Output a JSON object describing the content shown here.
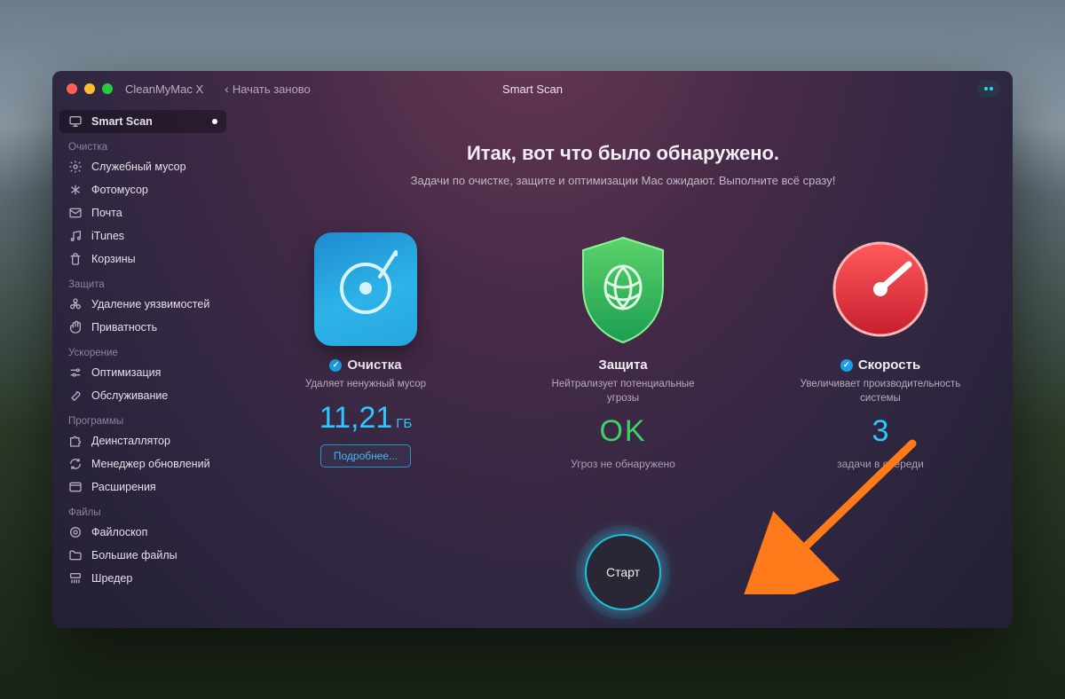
{
  "titlebar": {
    "app_title": "CleanMyMac X",
    "restart_label": "Начать заново",
    "center_title": "Smart Scan"
  },
  "sidebar": {
    "smart_scan": "Smart Scan",
    "sections": [
      {
        "title": "Очистка",
        "items": [
          "Служебный мусор",
          "Фотомусор",
          "Почта",
          "iTunes",
          "Корзины"
        ]
      },
      {
        "title": "Защита",
        "items": [
          "Удаление уязвимостей",
          "Приватность"
        ]
      },
      {
        "title": "Ускорение",
        "items": [
          "Оптимизация",
          "Обслуживание"
        ]
      },
      {
        "title": "Программы",
        "items": [
          "Деинсталлятор",
          "Менеджер обновлений",
          "Расширения"
        ]
      },
      {
        "title": "Файлы",
        "items": [
          "Файлоскоп",
          "Большие файлы",
          "Шредер"
        ]
      }
    ]
  },
  "main": {
    "heading": "Итак, вот что было обнаружено.",
    "subheading": "Задачи по очистке, защите и оптимизации Mac ожидают. Выполните всё сразу!",
    "clean": {
      "title": "Очистка",
      "desc": "Удаляет ненужный мусор",
      "value": "11,21",
      "unit": "ГБ",
      "more": "Подробнее..."
    },
    "protect": {
      "title": "Защита",
      "desc": "Нейтрализует потенциальные угрозы",
      "value": "OK",
      "status": "Угроз не обнаружено"
    },
    "speed": {
      "title": "Скорость",
      "desc": "Увеличивает производительность системы",
      "value": "3",
      "status": "задачи в очереди"
    },
    "start": "Старт"
  }
}
